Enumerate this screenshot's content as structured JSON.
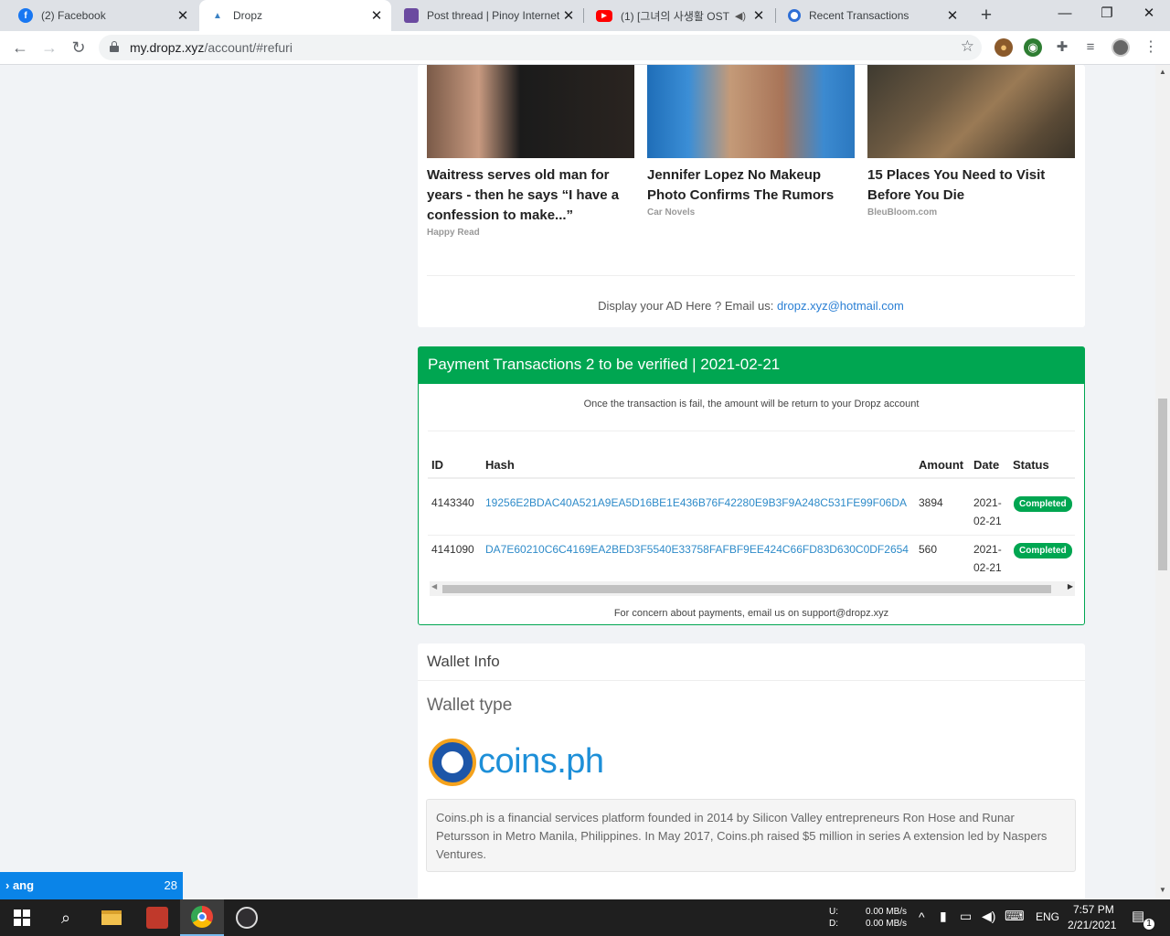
{
  "browser": {
    "tabs": [
      {
        "title": "(2) Facebook",
        "icon": "facebook-icon",
        "color": "#1877f2"
      },
      {
        "title": "Dropz",
        "icon": "dropz-icon",
        "color": "#3b82c4"
      },
      {
        "title": "Post thread | Pinoy Internet",
        "icon": "pinoy-icon",
        "color": "#6b4aa0"
      },
      {
        "title": "(1) [그녀의 사생활 OST",
        "icon": "youtube-icon",
        "color": "#ff0000"
      },
      {
        "title": "Recent Transactions",
        "icon": "coin-icon",
        "color": "#2f6fd6"
      }
    ],
    "url_host": "my.dropz.xyz",
    "url_path": "/account/#refuri"
  },
  "ads": [
    {
      "headline": "Waitress serves old man for years - then he says “I have a confession to make...”",
      "source": "Happy Read"
    },
    {
      "headline": "Jennifer Lopez No Makeup Photo Confirms The Rumors",
      "source": "Car Novels"
    },
    {
      "headline": "15 Places You Need to Visit Before You Die",
      "source": "BleuBloom.com"
    }
  ],
  "ad_line": {
    "text": "Display your AD Here ? Email us: ",
    "email": "dropz.xyz@hotmail.com"
  },
  "payments": {
    "title": "Payment Transactions 2 to be verified | 2021-02-21",
    "note": "Once the transaction is fail, the amount will be return to your Dropz account",
    "headers": {
      "id": "ID",
      "hash": "Hash",
      "amount": "Amount",
      "date": "Date",
      "status": "Status"
    },
    "rows": [
      {
        "id": "4143340",
        "hash": "19256E2BDAC40A521A9EA5D16BE1E436B76F42280E9B3F9A248C531FE99F06DA",
        "amount": "3894",
        "date_1": "2021-",
        "date_2": "02-21",
        "status": "Completed"
      },
      {
        "id": "4141090",
        "hash": "DA7E60210C6C4169EA2BED3F5540E33758FAFBF9EE424C66FD83D630C0DF2654",
        "amount": "560",
        "date_1": "2021-",
        "date_2": "02-21",
        "status": "Completed"
      }
    ],
    "footer": "For concern about payments, email us on support@dropz.xyz"
  },
  "wallet": {
    "title": "Wallet Info",
    "type_label": "Wallet type",
    "logo_text": "coins.ph",
    "description": "Coins.ph is a financial services platform founded in 2014 by Silicon Valley entrepreneurs Ron Hose and Runar Petursson in Metro Manila, Philippines. In May 2017, Coins.ph raised $5 million in series A extension led by Naspers Ventures."
  },
  "widget": {
    "label": "ang",
    "count": "28"
  },
  "taskbar": {
    "net_up_label": "U:",
    "net_down_label": "D:",
    "net_up": "0.00 MB/s",
    "net_down": "0.00 MB/s",
    "lang": "ENG",
    "time": "7:57 PM",
    "date": "2/21/2021",
    "notif_count": "1"
  },
  "colors": {
    "accent": "#00a651",
    "link": "#2e8bc9"
  }
}
